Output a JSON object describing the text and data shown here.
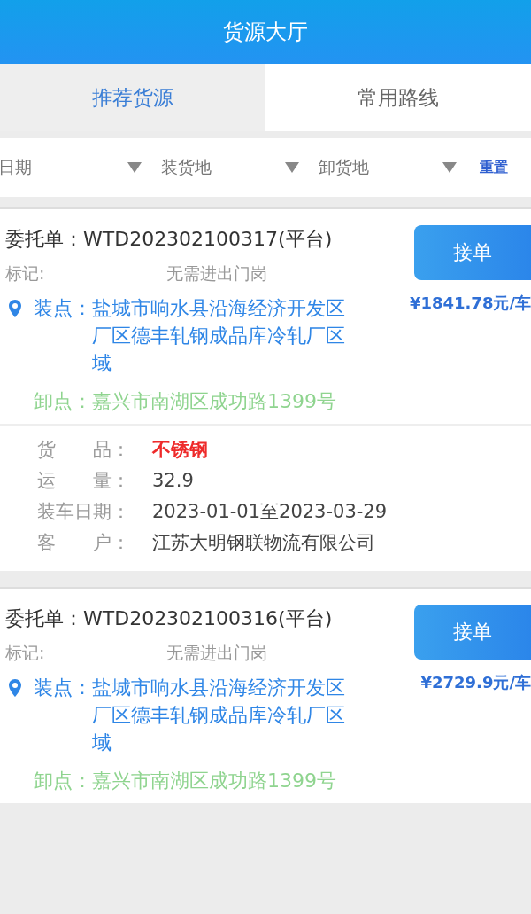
{
  "header": {
    "title": "货源大厅"
  },
  "tabs": [
    {
      "label": "推荐货源",
      "selected": true
    },
    {
      "label": "常用路线",
      "selected": false
    }
  ],
  "filters": [
    {
      "label": "日期"
    },
    {
      "label": "装货地"
    },
    {
      "label": "卸货地"
    }
  ],
  "reset": "重置",
  "orders": [
    {
      "order_label": "委托单：",
      "order_no": "WTD202302100317(平台)",
      "button": "接单",
      "mark_label": "标记:",
      "mark_value": "无需进出门岗",
      "price": "¥1841.78元/车",
      "load_label": "装点：",
      "load_address": "盐城市响水县沿海经济开发区厂区德丰轧钢成品库冷轧厂区域",
      "unload_label": "卸点：",
      "unload_address": "嘉兴市南湖区成功路1399号",
      "details": [
        {
          "label": "货　　品：",
          "value": "不锈钢",
          "highlight": true
        },
        {
          "label": "运　　量：",
          "value": "32.9",
          "highlight": false
        },
        {
          "label": "装车日期：",
          "value": "2023-01-01至2023-03-29",
          "highlight": false
        },
        {
          "label": "客　　户：",
          "value": "江苏大明钢联物流有限公司",
          "highlight": false
        }
      ]
    },
    {
      "order_label": "委托单：",
      "order_no": "WTD202302100316(平台)",
      "button": "接单",
      "mark_label": "标记:",
      "mark_value": "无需进出门岗",
      "price": "¥2729.9元/车",
      "load_label": "装点：",
      "load_address": "盐城市响水县沿海经济开发区厂区德丰轧钢成品库冷轧厂区域",
      "unload_label": "卸点：",
      "unload_address": "嘉兴市南湖区成功路1399号"
    }
  ]
}
